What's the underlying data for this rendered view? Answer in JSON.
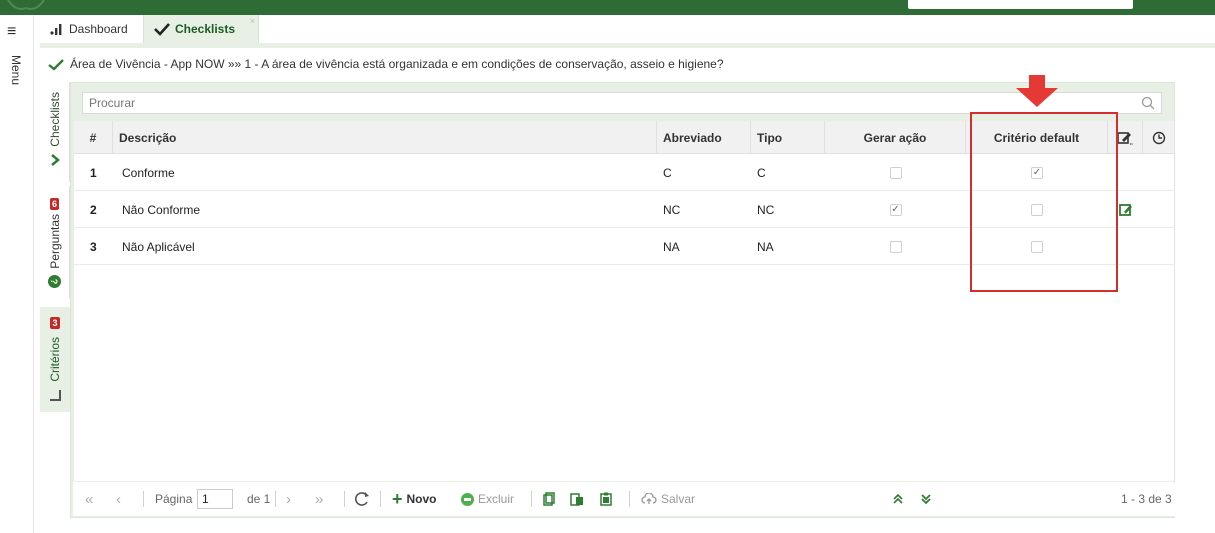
{
  "menu": {
    "label": "Menu"
  },
  "tabs": [
    {
      "label": "Dashboard"
    },
    {
      "label": "Checklists",
      "close": "×"
    }
  ],
  "breadcrumb": {
    "text": "Área de Vivência - App NOW »» 1 - A área de vivência está organizada e em condições de conservação, asseio e higiene?"
  },
  "side_tabs": {
    "checklists": {
      "label": "Checklists"
    },
    "perguntas": {
      "label": "Perguntas",
      "badge": "6"
    },
    "criterios": {
      "label": "Critérios",
      "badge": "3"
    }
  },
  "search": {
    "placeholder": "Procurar"
  },
  "table": {
    "columns": [
      "#",
      "Descrição",
      "Abreviado",
      "Tipo",
      "Gerar ação",
      "Critério default"
    ],
    "rows": [
      {
        "num": "1",
        "descricao": "Conforme",
        "abreviado": "C",
        "tipo": "C",
        "gerar_acao": false,
        "criterio_default": true,
        "editing": false
      },
      {
        "num": "2",
        "descricao": "Não Conforme",
        "abreviado": "NC",
        "tipo": "NC",
        "gerar_acao": true,
        "criterio_default": false,
        "editing": true
      },
      {
        "num": "3",
        "descricao": "Não Aplicável",
        "abreviado": "NA",
        "tipo": "NA",
        "gerar_acao": false,
        "criterio_default": false,
        "editing": false
      }
    ]
  },
  "pager": {
    "page_label": "Página",
    "page_value": "1",
    "of_label": "de 1",
    "new_label": "Novo",
    "delete_label": "Excluir",
    "save_label": "Salvar",
    "count": "1 - 3 de 3"
  },
  "colors": {
    "brand_green": "#2f6b35",
    "accent_green": "#2e7d32",
    "highlight_red": "#d32f2f",
    "badge_red": "#c62828",
    "panel_bg": "#e8f0e6"
  }
}
